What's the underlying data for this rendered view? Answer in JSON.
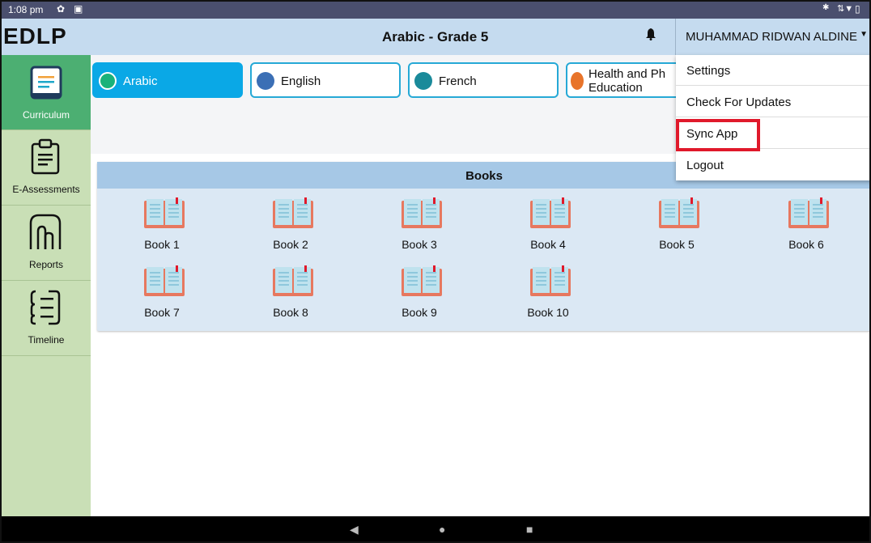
{
  "status_bar": {
    "time": "1:08 pm"
  },
  "app": {
    "brand": "EDLP",
    "title": "Arabic - Grade 5",
    "user": "MUHAMMAD RIDWAN ALDINE"
  },
  "sidebar": {
    "items": [
      {
        "label": "Curriculum",
        "icon": "curriculum-icon",
        "active": true
      },
      {
        "label": "E-Assessments",
        "icon": "clipboard-icon",
        "active": false
      },
      {
        "label": "Reports",
        "icon": "reports-icon",
        "active": false
      },
      {
        "label": "Timeline",
        "icon": "timeline-icon",
        "active": false
      }
    ]
  },
  "tabs": [
    {
      "label": "Arabic",
      "active": true
    },
    {
      "label": "English",
      "active": false
    },
    {
      "label": "French",
      "active": false
    },
    {
      "label": "Health and Ph",
      "label_line2": "Education",
      "active": false
    }
  ],
  "books": {
    "title": "Books",
    "items": [
      "Book 1",
      "Book 2",
      "Book 3",
      "Book 4",
      "Book 5",
      "Book 6",
      "Book 7",
      "Book 8",
      "Book 9",
      "Book 10"
    ]
  },
  "menu": {
    "items": [
      "Settings",
      "Check For Updates",
      "Sync App",
      "Logout"
    ],
    "highlighted": "Sync App"
  },
  "colors": {
    "accent": "#0aa8e6",
    "sidebar": "#c9dfb6",
    "active_nav": "#4caf72",
    "highlight": "#e0192b",
    "header": "#c5dbef"
  }
}
